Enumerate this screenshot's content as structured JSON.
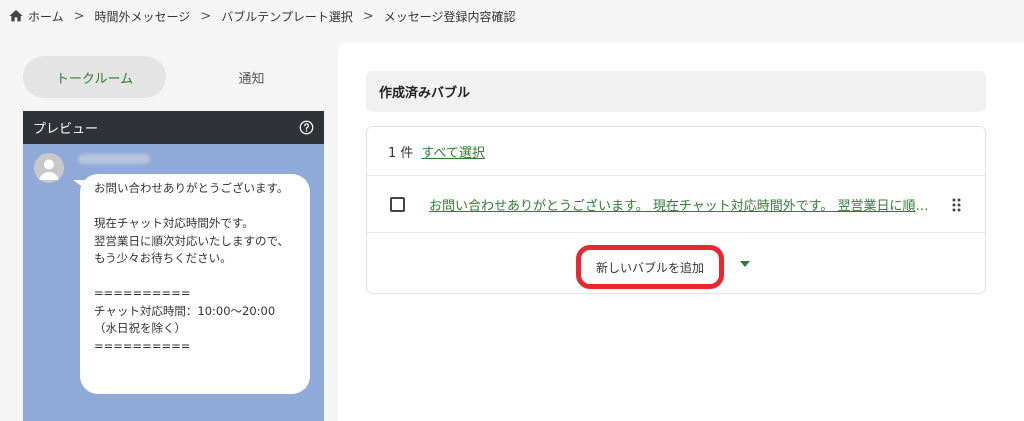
{
  "breadcrumb": {
    "items": [
      "ホーム",
      "時間外メッセージ",
      "バブルテンプレート選択",
      "メッセージ登録内容確認"
    ],
    "separator": ">",
    "icon": "home-icon"
  },
  "tabs": [
    {
      "label": "トークルーム",
      "active": true
    },
    {
      "label": "通知",
      "active": false
    }
  ],
  "preview": {
    "title": "プレビュー",
    "help_icon": "help-circle-icon",
    "avatar_icon": "person-icon",
    "message": "お問い合わせありがとうございます。\n\n現在チャット対応時間外です。\n翌営業日に順次対応いたしますので、もう少々お待ちください。\n\n==========\nチャット対応時間：10:00〜20:00\n（水日祝を除く）\n=========="
  },
  "created_bubbles": {
    "title": "作成済みバブル",
    "count_label": "1 件",
    "select_all_label": "すべて選択",
    "items": [
      {
        "text": "お問い合わせありがとうございます。 現在チャット対応時間外です。 翌営業日に順次対応いたしますので、もう少々お待ちください。"
      }
    ],
    "add_button_label": "新しいバブルを追加",
    "add_menu_icon": "caret-down-icon"
  },
  "colors": {
    "accent_green": "#2e7d32",
    "highlight_red": "#e8282f",
    "preview_bg": "#8fa9d9",
    "preview_header": "#2f3338"
  }
}
